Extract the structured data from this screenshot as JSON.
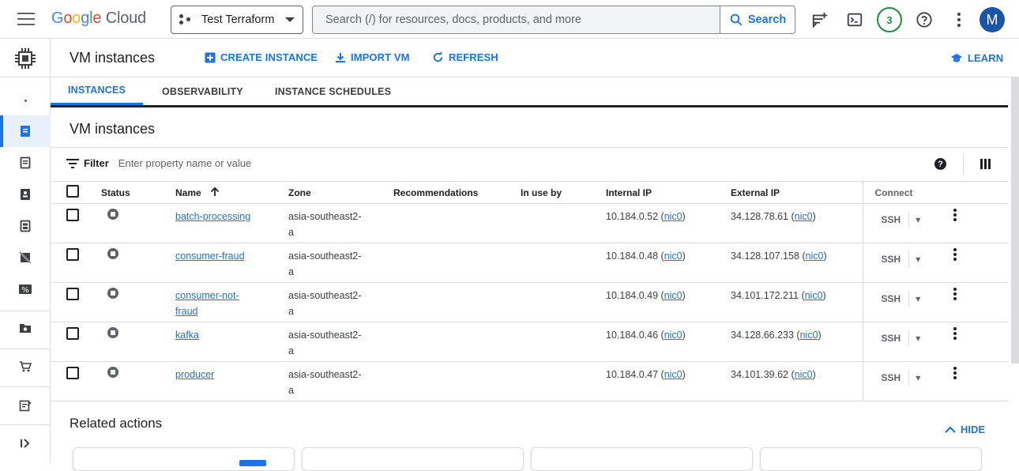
{
  "topbar": {
    "logo": {
      "g": "G",
      "o1": "o",
      "o2": "o",
      "g2": "g",
      "l": "l",
      "e": "e",
      "cloud": "Cloud"
    },
    "project_name": "Test Terraform",
    "search_placeholder": "Search (/) for resources, docs, products, and more",
    "search_button": "Search",
    "notification_count": "3",
    "avatar_letter": "M"
  },
  "header": {
    "title": "VM instances",
    "actions": {
      "create": "CREATE INSTANCE",
      "import": "IMPORT VM",
      "refresh": "REFRESH"
    },
    "learn": "LEARN"
  },
  "tabs": [
    "INSTANCES",
    "OBSERVABILITY",
    "INSTANCE SCHEDULES"
  ],
  "section_title": "VM instances",
  "filter": {
    "label": "Filter",
    "placeholder": "Enter property name or value"
  },
  "table": {
    "columns": {
      "status": "Status",
      "name": "Name",
      "zone": "Zone",
      "recommendations": "Recommendations",
      "in_use_by": "In use by",
      "internal_ip": "Internal IP",
      "external_ip": "External IP",
      "connect": "Connect"
    },
    "rows": [
      {
        "name": "batch-processing",
        "zone_1": "asia-southeast2-",
        "zone_2": "a",
        "internal_ip": "10.184.0.52",
        "external_ip": "34.128.78.61",
        "nic": "nic0",
        "connect": "SSH"
      },
      {
        "name": "consumer-fraud",
        "zone_1": "asia-southeast2-",
        "zone_2": "a",
        "internal_ip": "10.184.0.48",
        "external_ip": "34.128.107.158",
        "nic": "nic0",
        "connect": "SSH"
      },
      {
        "name_1": "consumer-not-",
        "name_2": "fraud",
        "zone_1": "asia-southeast2-",
        "zone_2": "a",
        "internal_ip": "10.184.0.49",
        "external_ip": "34.101.172.211",
        "nic": "nic0",
        "connect": "SSH"
      },
      {
        "name": "kafka",
        "zone_1": "asia-southeast2-",
        "zone_2": "a",
        "internal_ip": "10.184.0.46",
        "external_ip": "34.128.66.233",
        "nic": "nic0",
        "connect": "SSH"
      },
      {
        "name": "producer",
        "zone_1": "asia-southeast2-",
        "zone_2": "a",
        "internal_ip": "10.184.0.47",
        "external_ip": "34.101.39.62",
        "nic": "nic0",
        "connect": "SSH"
      }
    ]
  },
  "related": {
    "title": "Related actions",
    "hide": "HIDE"
  },
  "colors": {
    "accent": "#1a73e8",
    "nav_active_bg": "#e8f0fe",
    "badge_green": "#1e8e3e",
    "avatar": "#1a56a8"
  },
  "icons": [
    "menu-icon",
    "project-dots-icon",
    "search-icon",
    "notifications-icon",
    "cloud-shell-icon",
    "help-icon",
    "more-vert-icon",
    "compute-engine-icon",
    "sort-up-icon",
    "column-display-icon"
  ]
}
